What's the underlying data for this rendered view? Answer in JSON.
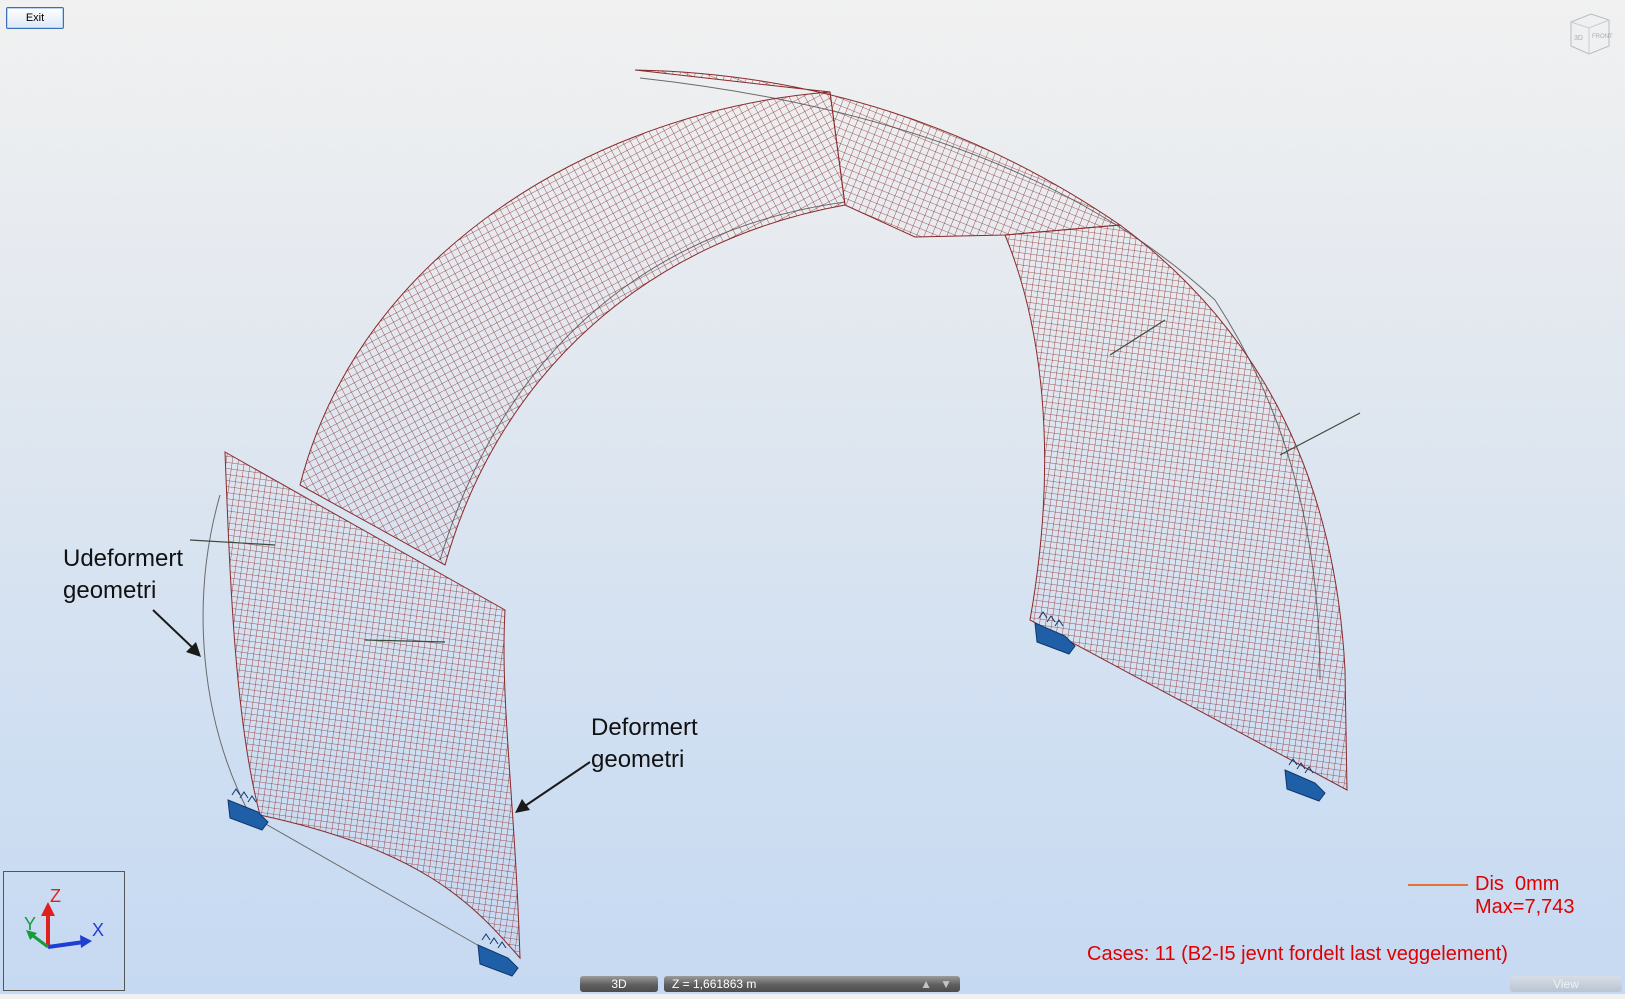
{
  "toolbar": {
    "exit_label": "Exit"
  },
  "view_cube": {
    "top_label": "3D",
    "front_label": "FRONT"
  },
  "annotations": {
    "undeformed": "Udeformert\ngeometri",
    "deformed": "Deformert\ngeometri"
  },
  "axis_triad": {
    "z": "Z",
    "y": "Y",
    "x": "X"
  },
  "legend": {
    "line1": "Dis  0mm",
    "line2": "Max=7,743",
    "line_color": "#e8703a"
  },
  "cases": "Cases: 11 (B2-I5 jevnt fordelt last veggelement)",
  "status_bar": {
    "view_mode": "3D",
    "z_level": "Z = 1,661863 m",
    "view_label": "View"
  },
  "colors": {
    "mesh": "#8a2a2a",
    "support": "#1f5fa8",
    "result_text": "#e00000"
  },
  "icons": [
    "view-cube-icon",
    "axis-triad-icon",
    "support-icon",
    "up-arrow-icon",
    "down-arrow-icon"
  ]
}
